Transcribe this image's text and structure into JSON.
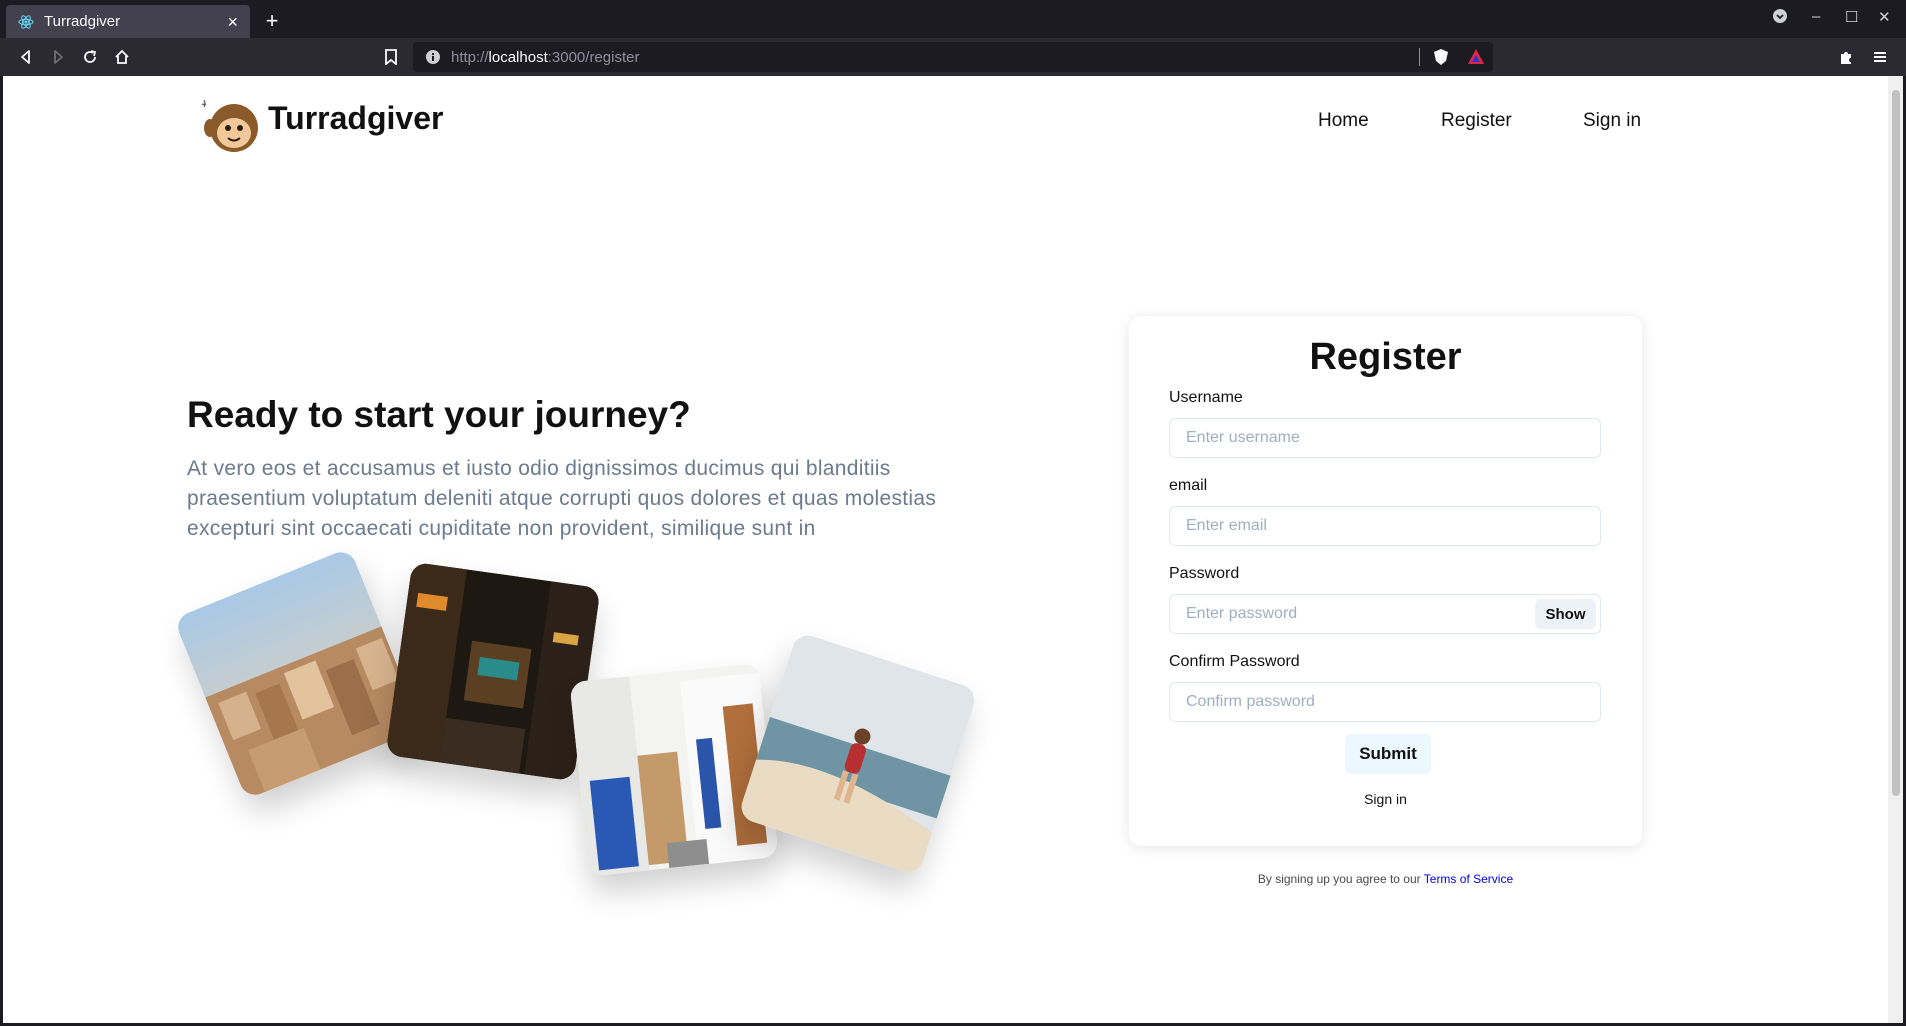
{
  "browser": {
    "tab_title": "Turradgiver",
    "tab_close": "×",
    "new_tab": "+",
    "url_prefix": "http://",
    "url_host": "localhost",
    "url_path": ":3000/register",
    "window_controls": [
      "⌄",
      "–",
      "☐",
      "✕"
    ]
  },
  "header": {
    "brand": "Turradgiver",
    "nav": [
      "Home",
      "Register",
      "Sign in"
    ]
  },
  "hero": {
    "title": "Ready to start your journey?",
    "text": "At vero eos et accusamus et iusto odio dignissimos ducimus qui blanditiis praesentium voluptatum deleniti atque corrupti quos dolores et quas molestias excepturi sint occaecati cupiditate non provident, similique sunt in"
  },
  "form": {
    "title": "Register",
    "username_label": "Username",
    "username_placeholder": "Enter username",
    "email_label": "email",
    "email_placeholder": "Enter email",
    "password_label": "Password",
    "password_placeholder": "Enter password",
    "show_label": "Show",
    "confirm_label": "Confirm Password",
    "confirm_placeholder": "Confirm password",
    "submit_label": "Submit",
    "signin_label": "Sign in"
  },
  "footer": {
    "terms_prefix": "By signing up you agree to our ",
    "terms_link": "Terms of Service"
  },
  "colors": {
    "accent_link": "#0000ee",
    "hero_text": "#6b7a8e",
    "submit_bg": "#ebf8ff"
  }
}
